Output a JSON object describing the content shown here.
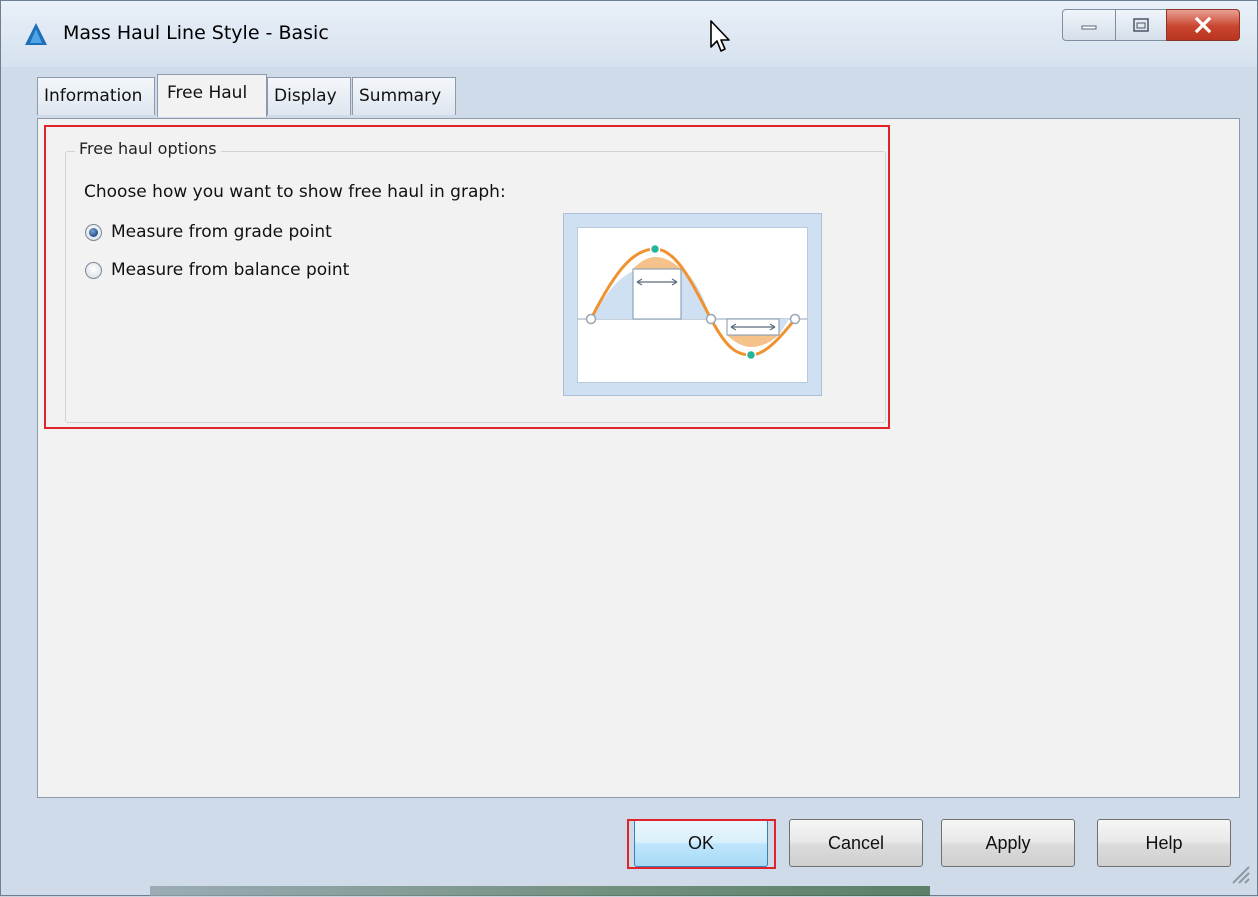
{
  "window": {
    "title": "Mass Haul Line Style - Basic",
    "app_icon": "civil3d-app-icon",
    "caption_buttons": [
      "minimize-icon",
      "maximize-icon",
      "close-icon"
    ]
  },
  "tabs": [
    {
      "label": "Information",
      "active": false
    },
    {
      "label": "Free Haul",
      "active": true
    },
    {
      "label": "Display",
      "active": false
    },
    {
      "label": "Summary",
      "active": false
    }
  ],
  "free_haul": {
    "group_title": "Free haul options",
    "prompt": "Choose how you want to show free haul in graph:",
    "options": [
      {
        "label": "Measure from grade point",
        "checked": true
      },
      {
        "label": "Measure from balance point",
        "checked": false
      }
    ],
    "preview_icon": "free-haul-preview-graphic"
  },
  "buttons": {
    "ok": "OK",
    "cancel": "Cancel",
    "apply": "Apply",
    "help": "Help"
  },
  "colors": {
    "highlight": "#e0242b",
    "curve": "#f0922f",
    "point": "#29b39b",
    "fill": "#cfe0f2"
  }
}
